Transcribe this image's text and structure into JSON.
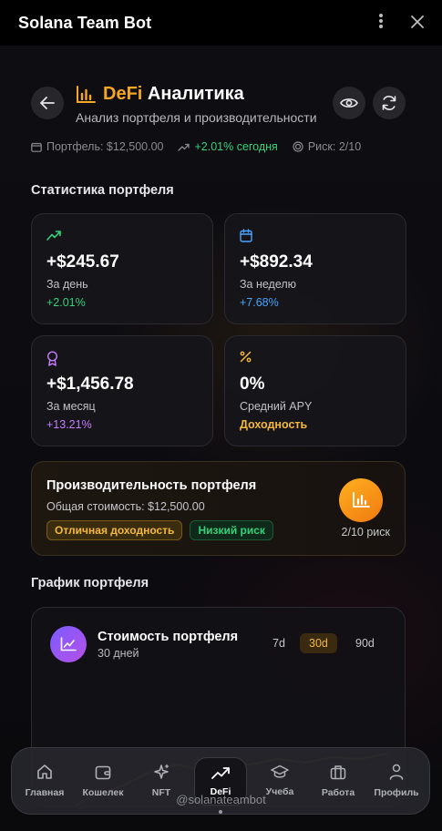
{
  "window": {
    "title": "Solana Team Bot",
    "menu_icon": "more-vertical-icon",
    "close_icon": "close-icon"
  },
  "header": {
    "title_accent": "DeFi",
    "title_rest": "Аналитика",
    "subtitle": "Анализ портфеля и производительности",
    "meta": {
      "portfolio": "Портфель: $12,500.00",
      "change": "+2.01% сегодня",
      "risk": "Риск: 2/10"
    }
  },
  "stats": {
    "section_title": "Статистика портфеля",
    "cards": [
      {
        "value": "+$245.67",
        "label": "За день",
        "delta": "+2.01%",
        "color": "#33d17a",
        "icon": "trending-up-icon"
      },
      {
        "value": "+$892.34",
        "label": "За неделю",
        "delta": "+7.68%",
        "color": "#4aa3ff",
        "icon": "calendar-icon"
      },
      {
        "value": "+$1,456.78",
        "label": "За месяц",
        "delta": "+13.21%",
        "color": "#c77dff",
        "icon": "award-icon"
      },
      {
        "value": "0%",
        "label": "Средний APY",
        "delta": "Доходность",
        "color": "#f5b83a",
        "icon": "percent-icon"
      }
    ]
  },
  "performance": {
    "title": "Производительность портфеля",
    "subtitle": "Общая стоимость: $12,500.00",
    "badge_yield": "Отличная доходность",
    "badge_risk": "Низкий риск",
    "risk_text": "2/10 риск"
  },
  "chart_section": {
    "title": "График портфеля",
    "card_title": "Стоимость портфеля",
    "card_subtitle": "30 дней",
    "ranges": [
      "7d",
      "30d",
      "90d"
    ],
    "active_range": "30d"
  },
  "nav": {
    "tabs": [
      {
        "label": "Главная",
        "icon": "home-icon"
      },
      {
        "label": "Кошелек",
        "icon": "wallet-icon"
      },
      {
        "label": "NFT",
        "icon": "sparkles-icon"
      },
      {
        "label": "DeFi",
        "icon": "trending-up-icon",
        "active": true
      },
      {
        "label": "Учеба",
        "icon": "graduation-cap-icon"
      },
      {
        "label": "Работа",
        "icon": "briefcase-icon"
      },
      {
        "label": "Профиль",
        "icon": "user-icon"
      }
    ]
  },
  "footer": {
    "handle": "@solanateambot"
  }
}
